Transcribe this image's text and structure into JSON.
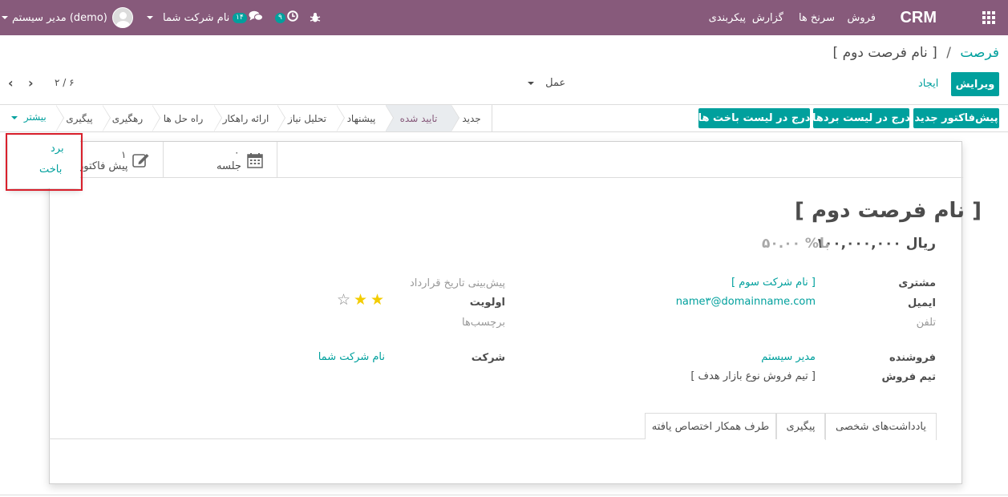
{
  "navbar": {
    "brand": "CRM",
    "menu": [
      "فروش",
      "سرنخ ها",
      "گزارش",
      "پیکربندی"
    ],
    "messages_count": "۱۴",
    "activities_count": "۹",
    "company": "نام شرکت شما",
    "user": "مدیر سیستم (demo)",
    "icons": [
      "apps-icon",
      "bug-icon",
      "clock-icon",
      "chat-icon",
      "avatar"
    ]
  },
  "control_panel": {
    "breadcrumb_parent": "فرصت",
    "breadcrumb_separator": "/",
    "breadcrumb_current": "[ نام فرصت دوم ]",
    "edit_label": "ویرایش",
    "create_label": "ایجاد",
    "action_label": "عمل",
    "pager": "۲ / ۶"
  },
  "header_buttons": {
    "new_quotation": "پیش‌فاکتور جدید",
    "mark_won": "درج در لیست بردها",
    "mark_lost": "درج در لیست باخت ها"
  },
  "statusbar": {
    "stages": [
      "جدید",
      "تایید شده",
      "پیشنهاد",
      "تحلیل نیاز",
      "ارائه راهکار",
      "راه حل ها",
      "رهگیری",
      "پیگیری"
    ],
    "active_stage": "تایید شده",
    "more_label": "بیشتر"
  },
  "more_dropdown": {
    "items": [
      "برد",
      "باخت"
    ]
  },
  "smart_buttons": {
    "meetings_value": "۰",
    "meetings_label": "جلسه",
    "quotations_value": "۱",
    "quotations_label": "پیش فاکتور"
  },
  "opportunity": {
    "title": "[ نام فرصت دوم ]",
    "revenue": "۱۰۰,۰۰۰,۰۰۰ ریال",
    "with_label": "با",
    "probability": "۵۰.۰۰ %",
    "customer_label": "مشتری",
    "customer_value": "[ نام شرکت سوم ]",
    "email_label": "ایمیل",
    "email_value": "name۳@domainname.com",
    "phone_label": "تلفن",
    "expected_closing_label": "پیش‌بینی تاریخ قرارداد",
    "priority_label": "اولویت",
    "priority_stars": 2,
    "priority_max": 3,
    "tags_label": "برچسب‌ها",
    "salesperson_label": "فروشنده",
    "salesperson_value": "مدیر سیستم",
    "sales_team_label": "تیم فروش",
    "sales_team_value": "[ تیم فروش نوع بازار هدف ]",
    "company_label": "شرکت",
    "company_value": "نام شرکت شما"
  },
  "tabs": [
    "یادداشت‌های شخصی",
    "پیگیری",
    "طرف همکار اختصاص یافته"
  ],
  "colors": {
    "navbar": "#875a7b",
    "primary": "#00a09d",
    "star": "#f3cc00",
    "highlight": "#d9202c"
  }
}
